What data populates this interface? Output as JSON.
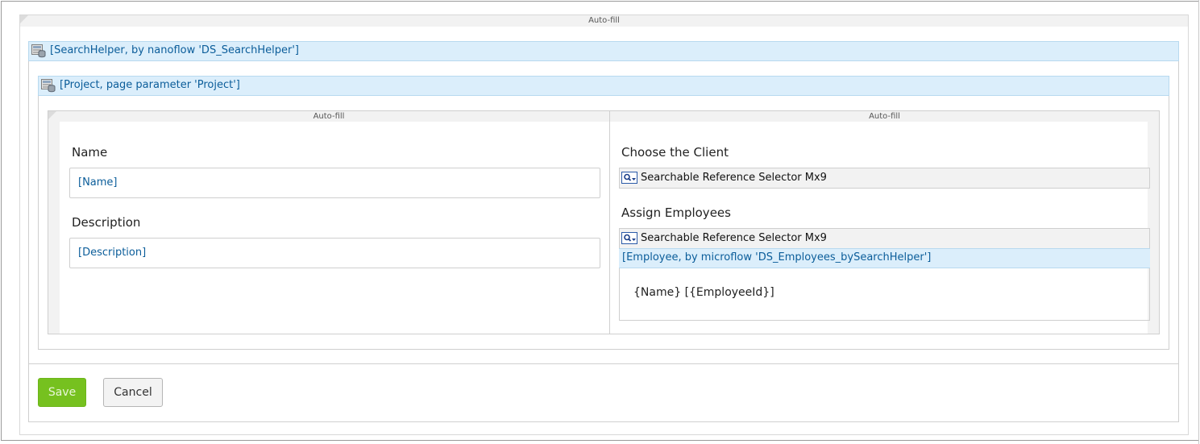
{
  "outer_container": {
    "autofill_label": "Auto-fill"
  },
  "search_helper": {
    "header": "[SearchHelper, by nanoflow 'DS_SearchHelper']"
  },
  "project": {
    "header": "[Project, page parameter 'Project']"
  },
  "left_column": {
    "autofill_label": "Auto-fill",
    "name_label": "Name",
    "name_value": "[Name]",
    "description_label": "Description",
    "description_value": "[Description]"
  },
  "right_column": {
    "autofill_label": "Auto-fill",
    "client_label": "Choose the Client",
    "client_selector": "Searchable Reference Selector Mx9",
    "employees_label": "Assign Employees",
    "employees_selector": "Searchable Reference Selector Mx9",
    "employee_source": "[Employee, by microflow 'DS_Employees_bySearchHelper']",
    "employee_template": "{Name} [{EmployeeId}]"
  },
  "footer": {
    "save_label": "Save",
    "cancel_label": "Cancel"
  },
  "colors": {
    "accent_green": "#76c11f",
    "ds_header_bg": "#dbeefb",
    "ds_header_text": "#0b5d9a"
  },
  "icons": {
    "datasource": "datasource-icon",
    "selector": "search-dropdown-icon"
  }
}
